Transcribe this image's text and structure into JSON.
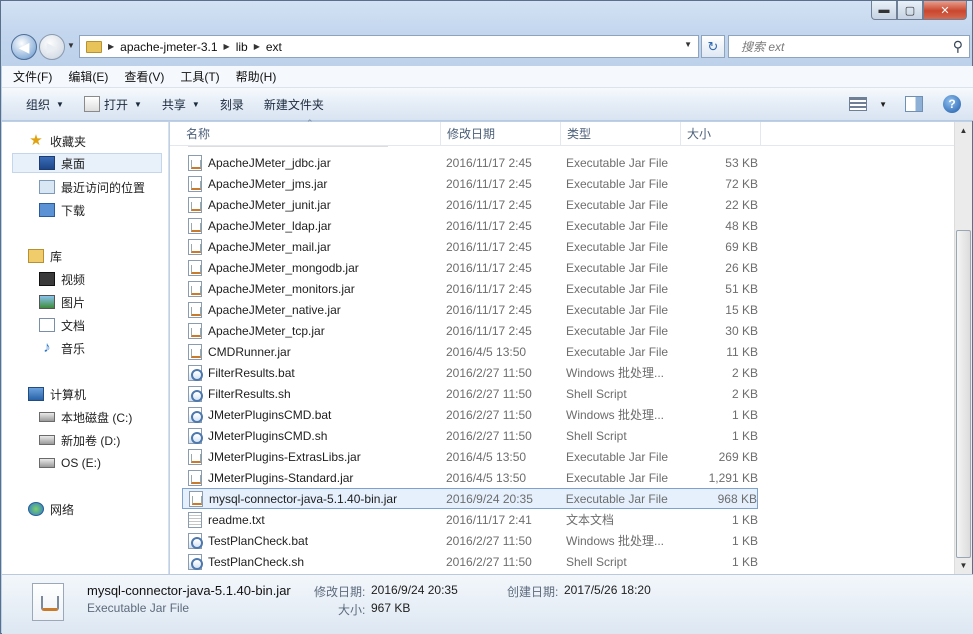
{
  "window": {
    "caption_buttons": {
      "minimize": "▬",
      "maximize": "▢",
      "close": "✕"
    }
  },
  "navbar": {
    "breadcrumbs": [
      "apache-jmeter-3.1",
      "lib",
      "ext"
    ],
    "search_placeholder": "搜索 ext"
  },
  "menu": [
    "文件(F)",
    "编辑(E)",
    "查看(V)",
    "工具(T)",
    "帮助(H)"
  ],
  "toolbar": {
    "organize": "组织",
    "open": "打开",
    "share": "共享",
    "burn": "刻录",
    "new_folder": "新建文件夹"
  },
  "sidebar": {
    "favorites": {
      "label": "收藏夹",
      "items": [
        "桌面",
        "最近访问的位置",
        "下载"
      ]
    },
    "libraries": {
      "label": "库",
      "items": [
        "视频",
        "图片",
        "文档",
        "音乐"
      ]
    },
    "computer": {
      "label": "计算机",
      "items": [
        "本地磁盘 (C:)",
        "新加卷 (D:)",
        "OS (E:)"
      ]
    },
    "network": {
      "label": "网络"
    }
  },
  "columns": {
    "name": "名称",
    "date": "修改日期",
    "type": "类型",
    "size": "大小"
  },
  "files": [
    {
      "name": "ApacheJMeter_jdbc.jar",
      "date": "2016/11/17 2:45",
      "type": "Executable Jar File",
      "size": "53 KB",
      "icon": "jar-file-icon"
    },
    {
      "name": "ApacheJMeter_jms.jar",
      "date": "2016/11/17 2:45",
      "type": "Executable Jar File",
      "size": "72 KB",
      "icon": "jar-file-icon"
    },
    {
      "name": "ApacheJMeter_junit.jar",
      "date": "2016/11/17 2:45",
      "type": "Executable Jar File",
      "size": "22 KB",
      "icon": "jar-file-icon"
    },
    {
      "name": "ApacheJMeter_ldap.jar",
      "date": "2016/11/17 2:45",
      "type": "Executable Jar File",
      "size": "48 KB",
      "icon": "jar-file-icon"
    },
    {
      "name": "ApacheJMeter_mail.jar",
      "date": "2016/11/17 2:45",
      "type": "Executable Jar File",
      "size": "69 KB",
      "icon": "jar-file-icon"
    },
    {
      "name": "ApacheJMeter_mongodb.jar",
      "date": "2016/11/17 2:45",
      "type": "Executable Jar File",
      "size": "26 KB",
      "icon": "jar-file-icon"
    },
    {
      "name": "ApacheJMeter_monitors.jar",
      "date": "2016/11/17 2:45",
      "type": "Executable Jar File",
      "size": "51 KB",
      "icon": "jar-file-icon"
    },
    {
      "name": "ApacheJMeter_native.jar",
      "date": "2016/11/17 2:45",
      "type": "Executable Jar File",
      "size": "15 KB",
      "icon": "jar-file-icon"
    },
    {
      "name": "ApacheJMeter_tcp.jar",
      "date": "2016/11/17 2:45",
      "type": "Executable Jar File",
      "size": "30 KB",
      "icon": "jar-file-icon"
    },
    {
      "name": "CMDRunner.jar",
      "date": "2016/4/5 13:50",
      "type": "Executable Jar File",
      "size": "11 KB",
      "icon": "jar-file-icon"
    },
    {
      "name": "FilterResults.bat",
      "date": "2016/2/27 11:50",
      "type": "Windows 批处理...",
      "size": "2 KB",
      "icon": "bat-file-icon"
    },
    {
      "name": "FilterResults.sh",
      "date": "2016/2/27 11:50",
      "type": "Shell Script",
      "size": "2 KB",
      "icon": "sh-file-icon"
    },
    {
      "name": "JMeterPluginsCMD.bat",
      "date": "2016/2/27 11:50",
      "type": "Windows 批处理...",
      "size": "1 KB",
      "icon": "bat-file-icon"
    },
    {
      "name": "JMeterPluginsCMD.sh",
      "date": "2016/2/27 11:50",
      "type": "Shell Script",
      "size": "1 KB",
      "icon": "sh-file-icon"
    },
    {
      "name": "JMeterPlugins-ExtrasLibs.jar",
      "date": "2016/4/5 13:50",
      "type": "Executable Jar File",
      "size": "269 KB",
      "icon": "jar-file-icon"
    },
    {
      "name": "JMeterPlugins-Standard.jar",
      "date": "2016/4/5 13:50",
      "type": "Executable Jar File",
      "size": "1,291 KB",
      "icon": "jar-file-icon"
    },
    {
      "name": "mysql-connector-java-5.1.40-bin.jar",
      "date": "2016/9/24 20:35",
      "type": "Executable Jar File",
      "size": "968 KB",
      "icon": "jar-file-icon",
      "selected": true
    },
    {
      "name": "readme.txt",
      "date": "2016/11/17 2:41",
      "type": "文本文档",
      "size": "1 KB",
      "icon": "txt-file-icon"
    },
    {
      "name": "TestPlanCheck.bat",
      "date": "2016/2/27 11:50",
      "type": "Windows 批处理...",
      "size": "1 KB",
      "icon": "bat-file-icon"
    },
    {
      "name": "TestPlanCheck.sh",
      "date": "2016/2/27 11:50",
      "type": "Shell Script",
      "size": "1 KB",
      "icon": "sh-file-icon"
    }
  ],
  "details": {
    "name": "mysql-connector-java-5.1.40-bin.jar",
    "type": "Executable Jar File",
    "modified_label": "修改日期:",
    "modified": "2016/9/24 20:35",
    "created_label": "创建日期:",
    "created": "2017/5/26 18:20",
    "size_label": "大小:",
    "size": "967 KB"
  }
}
